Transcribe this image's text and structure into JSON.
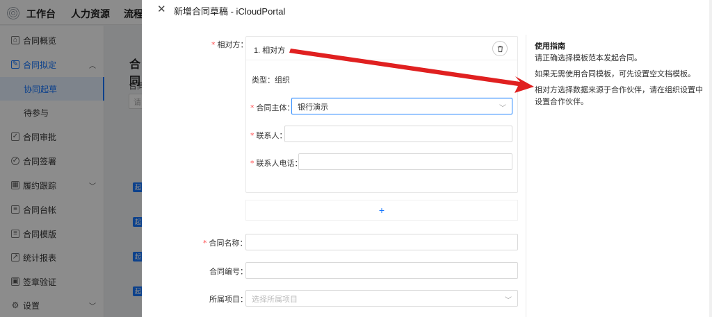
{
  "topbar": {
    "nav": [
      "工作台",
      "人力资源",
      "流程"
    ]
  },
  "sidebar": {
    "items": [
      {
        "label": "合同概览",
        "icon": "home-icon",
        "glyph": "⌂"
      },
      {
        "label": "合同拟定",
        "icon": "edit-icon",
        "glyph": "✎",
        "open": true
      },
      {
        "label": "协同起草",
        "sub": true,
        "active": true
      },
      {
        "label": "待参与",
        "sub": true
      },
      {
        "label": "合同审批",
        "icon": "check-square-icon",
        "glyph": "✓"
      },
      {
        "label": "合同签署",
        "icon": "shield-check-icon",
        "glyph": "✓"
      },
      {
        "label": "履约跟踪",
        "icon": "calendar-icon",
        "glyph": "▦",
        "chevron": "down"
      },
      {
        "label": "合同台帐",
        "icon": "file-search-icon",
        "glyph": "≡"
      },
      {
        "label": "合同模版",
        "icon": "file-icon",
        "glyph": "≡"
      },
      {
        "label": "统计报表",
        "icon": "line-chart-icon",
        "glyph": "↗"
      },
      {
        "label": "签章验证",
        "icon": "stamp-icon",
        "glyph": "▣"
      },
      {
        "label": "设置",
        "icon": "gear-icon",
        "glyph": "⚙",
        "chevron": "down"
      }
    ]
  },
  "background": {
    "title": "合同",
    "label": "合同",
    "input_placeholder": "请",
    "tags": [
      "起",
      "起",
      "起",
      "起"
    ]
  },
  "drawer": {
    "title": "新增合同草稿 - iCloudPortal",
    "counterparty_label": "相对方：",
    "party": {
      "name": "1. 相对方",
      "type_label": "类型：",
      "type_value": "组织",
      "subject_label": "合同主体：",
      "subject_value": "银行演示",
      "contact_label": "联系人：",
      "contact_value": "",
      "phone_label": "联系人电话：",
      "phone_value": ""
    },
    "add_symbol": "+",
    "contract_name_label": "合同名称：",
    "contract_name_value": "",
    "contract_no_label": "合同编号：",
    "contract_no_value": "",
    "project_label": "所属项目：",
    "project_placeholder": "选择所属项目"
  },
  "guide": {
    "title": "使用指南",
    "lines": [
      "请正确选择模板范本发起合同。",
      "如果无需使用合同模板，可先设置空文档模板。",
      "相对方选择数据来源于合作伙伴，请在组织设置中设置合作伙伴。"
    ]
  },
  "colors": {
    "accent": "#1677ff",
    "required": "#ff4d4f",
    "annotation_arrow": "#e02020"
  }
}
